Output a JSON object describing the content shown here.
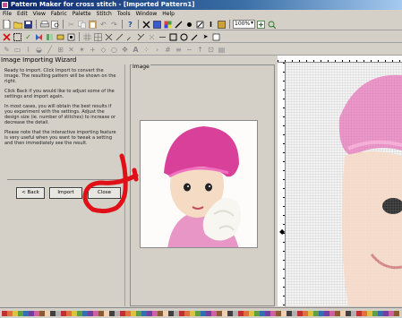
{
  "window": {
    "title": "Pattern Maker for cross stitch - [Imported Pattern1]"
  },
  "menu": [
    "File",
    "Edit",
    "View",
    "Fabric",
    "Palette",
    "Stitch",
    "Tools",
    "Window",
    "Help"
  ],
  "toolbar": {
    "zoom_value": "100%"
  },
  "wizard": {
    "title": "Image Importing Wizard",
    "paragraphs": [
      "Ready to import. Click Import to convert the image. The resulting pattern will be shown on the right.",
      "Click Back if you would like to adjust some of the settings and import again.",
      "In most cases, you will obtain the best results if you experiment with the settings. Adjust the design size (ie. number of stitches) to increase or decrease the detail.",
      "Please note that the interactive importing feature is very useful when you want to tweak a setting and then immediately see the result."
    ],
    "back_label": "< Back",
    "import_label": "Import",
    "close_label": "Close"
  },
  "image_panel": {
    "label": "Image"
  }
}
